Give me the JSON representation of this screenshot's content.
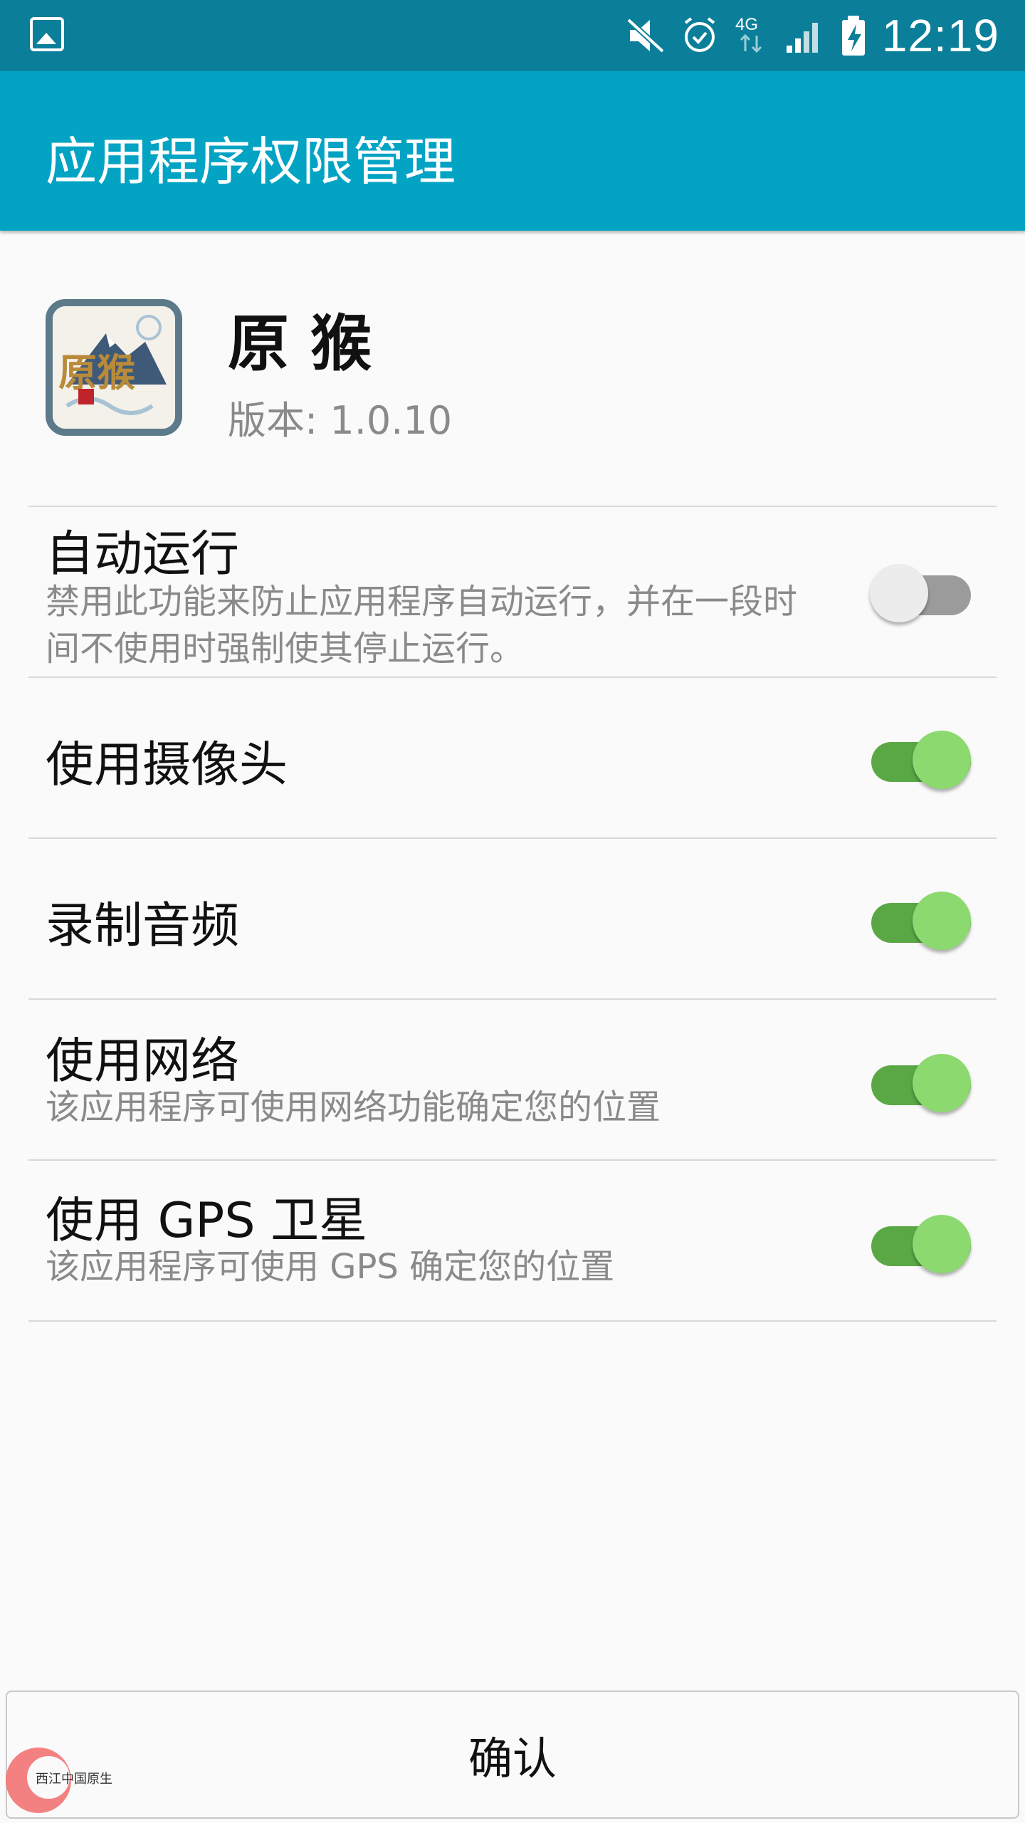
{
  "status_bar": {
    "time": "12:19",
    "network": "4G",
    "icons": [
      "gallery-icon",
      "mute-icon",
      "alarm-icon",
      "network-4g-icon",
      "signal-icon",
      "battery-charging-icon"
    ]
  },
  "app_bar": {
    "title": "应用程序权限管理"
  },
  "app": {
    "name": "原 猴",
    "version": "版本: 1.0.10",
    "icon_text": "原猴"
  },
  "permissions": [
    {
      "title": "自动运行",
      "description": "禁用此功能来防止应用程序自动运行，并在一段时间不使用时强制使其停止运行。",
      "enabled": false
    },
    {
      "title": "使用摄像头",
      "description": "",
      "enabled": true
    },
    {
      "title": "录制音频",
      "description": "",
      "enabled": true
    },
    {
      "title": "使用网络",
      "description": "该应用程序可使用网络功能确定您的位置",
      "enabled": true
    },
    {
      "title": "使用 GPS 卫星",
      "description": "该应用程序可使用 GPS 确定您的位置",
      "enabled": true
    }
  ],
  "confirm_label": "确认",
  "watermark_text": "西江中国原生",
  "colors": {
    "status_bar": "#0b7f99",
    "app_bar": "#03a3c4",
    "toggle_on_track": "#5aa845",
    "toggle_on_thumb": "#8bd96f",
    "toggle_off_track": "#9b9b9b"
  }
}
